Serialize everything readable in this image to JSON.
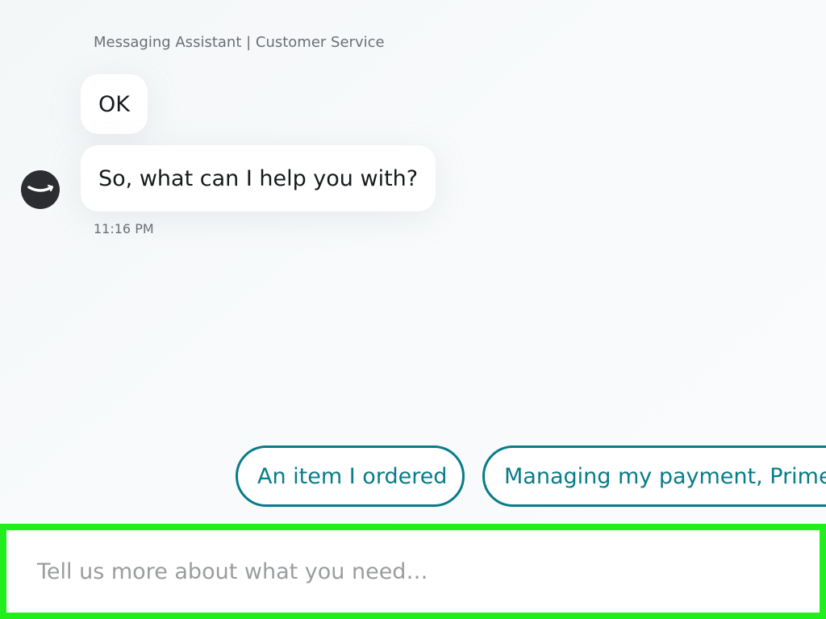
{
  "header": {
    "title": "Messaging Assistant | Customer Service"
  },
  "messages": [
    {
      "text": "OK"
    },
    {
      "text": "So, what can I help you with?"
    }
  ],
  "timestamp": "11:16 PM",
  "avatar": {
    "icon": "amazon-smile-icon"
  },
  "quick_replies": [
    {
      "label": "An item I ordered"
    },
    {
      "label": "Managing my payment, Prime,"
    }
  ],
  "composer": {
    "placeholder": "Tell us more about what you need…",
    "value": ""
  },
  "colors": {
    "accent": "#077c8a",
    "highlight": "#22ee1e",
    "avatar_bg": "#2b2d30"
  }
}
